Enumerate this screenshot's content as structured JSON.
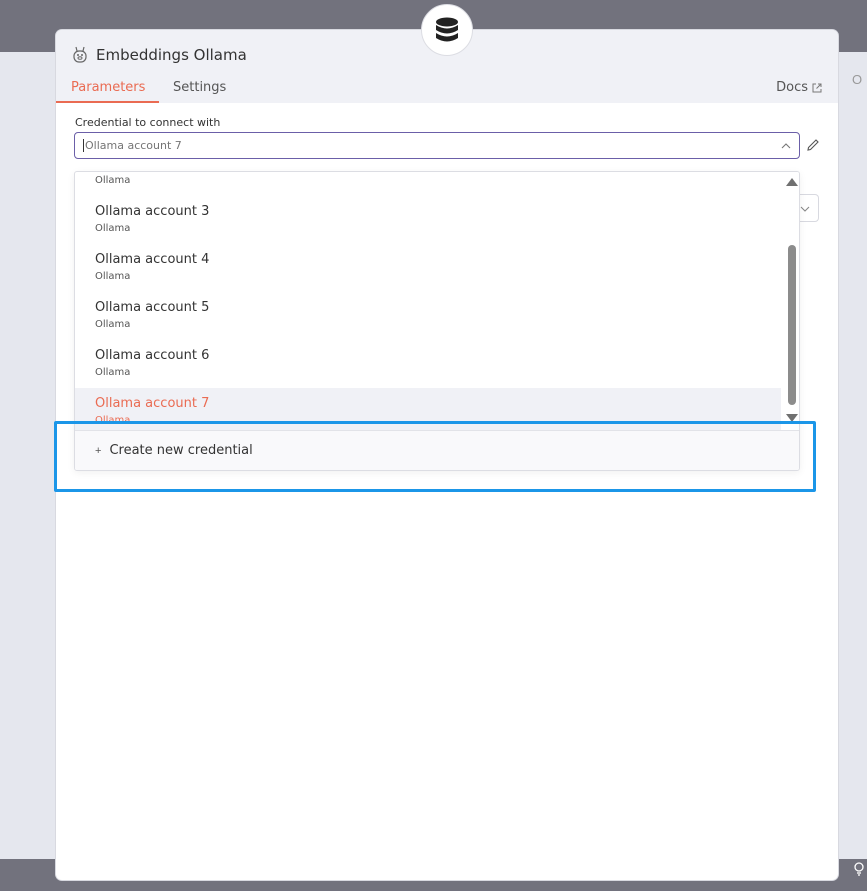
{
  "node": {
    "title": "Embeddings Ollama",
    "icon": "database-icon"
  },
  "tabs": {
    "parameters": "Parameters",
    "settings": "Settings",
    "docs": "Docs"
  },
  "credential": {
    "label": "Credential to connect with",
    "placeholder": "Ollama account 7"
  },
  "dropdown": {
    "partial_top_sub": "Ollama",
    "items": [
      {
        "name": "Ollama account 3",
        "type": "Ollama"
      },
      {
        "name": "Ollama account 4",
        "type": "Ollama"
      },
      {
        "name": "Ollama account 5",
        "type": "Ollama"
      },
      {
        "name": "Ollama account 6",
        "type": "Ollama"
      },
      {
        "name": "Ollama account 7",
        "type": "Ollama"
      }
    ],
    "selected": "Ollama account 7",
    "create_label": "Create new credential",
    "create_prefix": "+"
  },
  "side": {
    "right_peek": "O"
  },
  "colors": {
    "accent": "#ea6b52",
    "highlight": "#1b96e8",
    "topbar": "#72727d",
    "input_border": "#6b5fa8"
  }
}
